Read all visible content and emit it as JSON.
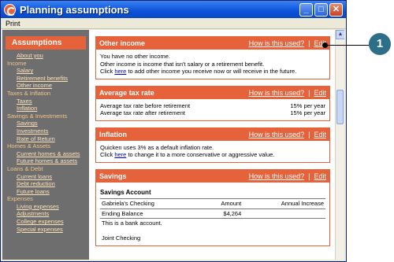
{
  "window": {
    "title": "Planning assumptions"
  },
  "menu": {
    "print": "Print"
  },
  "sidebar": {
    "header": "Assumptions",
    "entries": [
      {
        "kind": "item",
        "label": "About you"
      },
      {
        "kind": "cat",
        "label": "Income"
      },
      {
        "kind": "item",
        "label": "Salary"
      },
      {
        "kind": "item",
        "label": "Retirement benefits"
      },
      {
        "kind": "item",
        "label": "Other income"
      },
      {
        "kind": "cat",
        "label": "Taxes & Inflation"
      },
      {
        "kind": "item",
        "label": "Taxes"
      },
      {
        "kind": "item",
        "label": "Inflation"
      },
      {
        "kind": "cat",
        "label": "Savings & Investments"
      },
      {
        "kind": "item",
        "label": "Savings"
      },
      {
        "kind": "item",
        "label": "Investments"
      },
      {
        "kind": "item",
        "label": "Rate of Return"
      },
      {
        "kind": "cat",
        "label": "Homes & Assets"
      },
      {
        "kind": "item",
        "label": "Current homes & assets"
      },
      {
        "kind": "item",
        "label": "Future homes & assets"
      },
      {
        "kind": "cat",
        "label": "Loans & Debt"
      },
      {
        "kind": "item",
        "label": "Current loans"
      },
      {
        "kind": "item",
        "label": "Debt reduction"
      },
      {
        "kind": "item",
        "label": "Future loans"
      },
      {
        "kind": "cat",
        "label": "Expenses"
      },
      {
        "kind": "item",
        "label": "Living expenses"
      },
      {
        "kind": "item",
        "label": "Adjustments"
      },
      {
        "kind": "item",
        "label": "College expenses"
      },
      {
        "kind": "item",
        "label": "Special expenses"
      }
    ]
  },
  "panel_links": {
    "how": "How is this used?",
    "sep": "|",
    "edit": "Edit"
  },
  "other_income": {
    "title": "Other income",
    "line1": "You have no other income.",
    "line2": "Other income is income that isn't salary or a retirement benefit.",
    "line3_pre": "Click ",
    "line3_link": "here",
    "line3_post": " to add other income you receive now or will receive in the future."
  },
  "tax_rate": {
    "title": "Average tax rate",
    "rows": [
      {
        "label": "Average tax rate before retirement",
        "value": "15% per year"
      },
      {
        "label": "Average tax rate after retirement",
        "value": "15% per year"
      }
    ]
  },
  "inflation": {
    "title": "Inflation",
    "line1": "Quicken uses 3% as a default inflation rate.",
    "line2_pre": "Click ",
    "line2_link": "here",
    "line2_post": " to change it to a more conservative or aggressive value."
  },
  "savings": {
    "title": "Savings",
    "subtitle": "Savings Account",
    "account": "Gabriela's Checking",
    "col_amount": "Amount",
    "col_increase": "Annual Increase",
    "balance_label": "Ending Balance",
    "balance_value": "$4,264",
    "note": "This is a bank account.",
    "next": "Joint Checking"
  },
  "callout": {
    "number": "1"
  }
}
